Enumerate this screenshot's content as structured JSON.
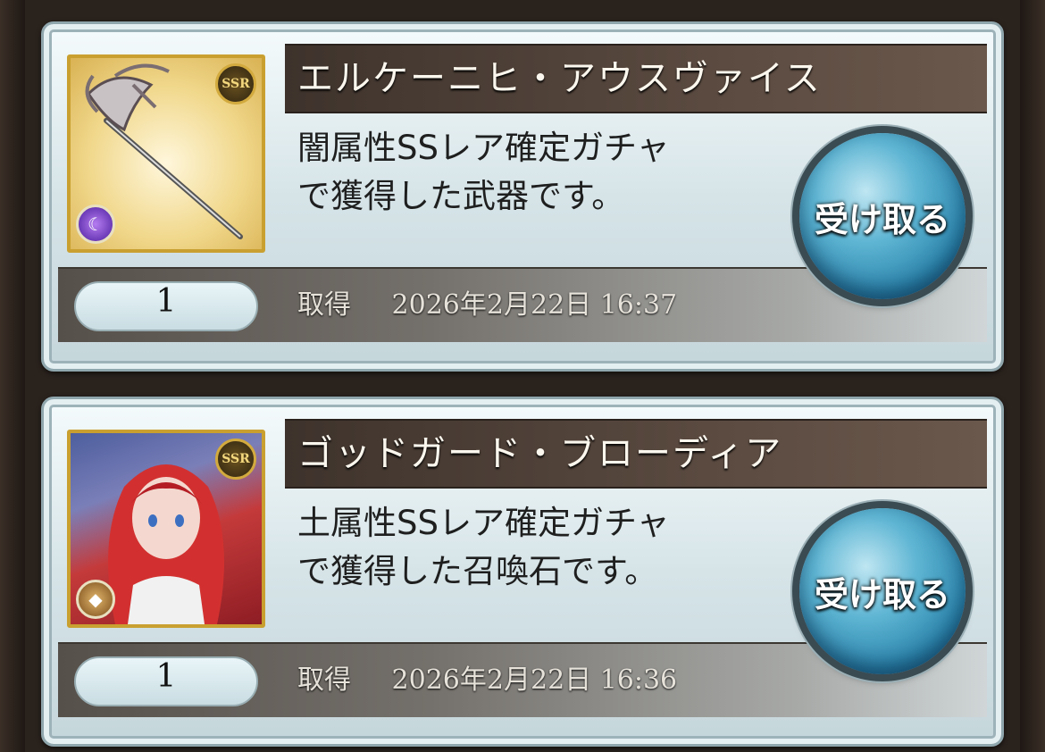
{
  "items": [
    {
      "name": "エルケーニヒ・アウスヴァイス",
      "desc_line1": "闇属性SSレア確定ガチャ",
      "desc_line2": "で獲得した武器です。",
      "count": "1",
      "acquired_label": "取得",
      "acquired_date": "2026年2月22日 16:37",
      "receive_label": "受け取る",
      "rarity": "SSR",
      "element_icon": "dark-element-icon",
      "thumb_icon": "weapon-staff-icon"
    },
    {
      "name": "ゴッドガード・ブローディア",
      "desc_line1": "土属性SSレア確定ガチャ",
      "desc_line2": "で獲得した召喚石です。",
      "count": "1",
      "acquired_label": "取得",
      "acquired_date": "2026年2月22日 16:36",
      "receive_label": "受け取る",
      "rarity": "SSR",
      "element_icon": "earth-element-icon",
      "thumb_icon": "summon-portrait-icon"
    }
  ],
  "colors": {
    "name_bar": "#3e332c",
    "card_bg": "#e4eff2",
    "button": "#2d86ad"
  }
}
